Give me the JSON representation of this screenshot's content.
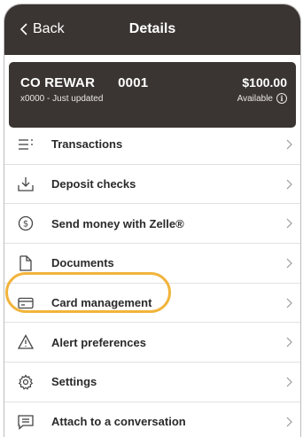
{
  "header": {
    "back_label": "Back",
    "title": "Details"
  },
  "account": {
    "name": "CO REWAR",
    "number": "0001",
    "subtitle": "x0000 - Just updated",
    "balance": "$100.00",
    "balance_label": "Available"
  },
  "menu": {
    "items": [
      {
        "label": "Transactions",
        "icon": "transactions-icon"
      },
      {
        "label": "Deposit checks",
        "icon": "deposit-icon"
      },
      {
        "label": "Send money with Zelle®",
        "icon": "dollar-circle-icon"
      },
      {
        "label": "Documents",
        "icon": "document-icon"
      },
      {
        "label": "Card management",
        "icon": "card-icon"
      },
      {
        "label": "Alert preferences",
        "icon": "warning-icon"
      },
      {
        "label": "Settings",
        "icon": "gear-icon"
      },
      {
        "label": "Attach to a conversation",
        "icon": "chat-icon"
      }
    ]
  },
  "colors": {
    "header_bg": "#3a3532",
    "highlight": "#f1b43c"
  }
}
